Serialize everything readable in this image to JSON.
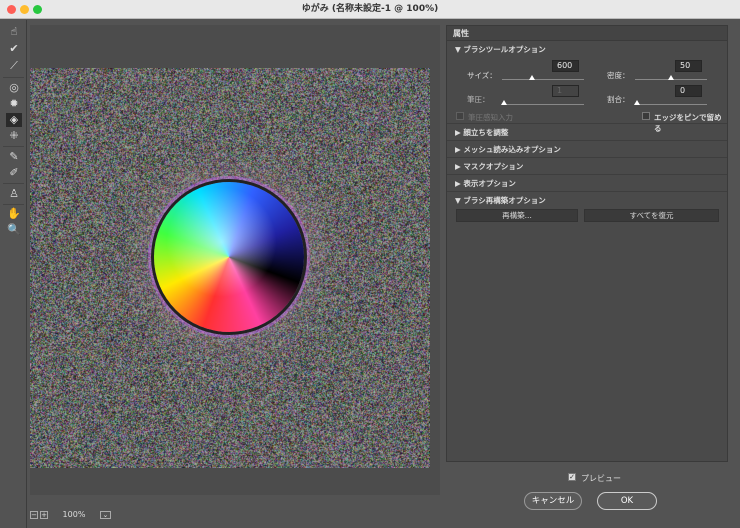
{
  "window": {
    "title": "ゆがみ (名称未設定-1 @ 100%)"
  },
  "tools": [
    "forward-warp",
    "reconstruct",
    "smooth",
    "twirl",
    "pucker",
    "bloat",
    "push-left",
    "freeze-mask",
    "thaw-mask",
    "face",
    "hand",
    "zoom"
  ],
  "panel": {
    "header": "属性",
    "brush_section": "▼ ブラシツールオプション",
    "size_label": "サイズ：",
    "size_value": "600",
    "size_fraction": 0.35,
    "density_label": "密度：",
    "density_value": "50",
    "density_fraction": 0.5,
    "pressure_label": "筆圧：",
    "pressure_value": "1",
    "pressure_fraction": 0,
    "rate_label": "割合：",
    "rate_value": "0",
    "rate_fraction": 0,
    "stylus_label": "筆圧感知入力",
    "pin_edges_label": "エッジをピンで留める",
    "sections": [
      "▶ 顔立ちを調整",
      "▶ メッシュ読み込みオプション",
      "▶ マスクオプション",
      "▶ 表示オプション"
    ],
    "reconstruct_section": "▼ ブラシ再構築オプション",
    "reconstruct_button": "再構築...",
    "restore_all_button": "すべてを復元"
  },
  "footer": {
    "zoom": "100%",
    "zoom_minus": "−",
    "zoom_plus": "+",
    "preview_label": "プレビュー",
    "preview_checked": true,
    "cancel": "キャンセル",
    "ok": "OK"
  }
}
